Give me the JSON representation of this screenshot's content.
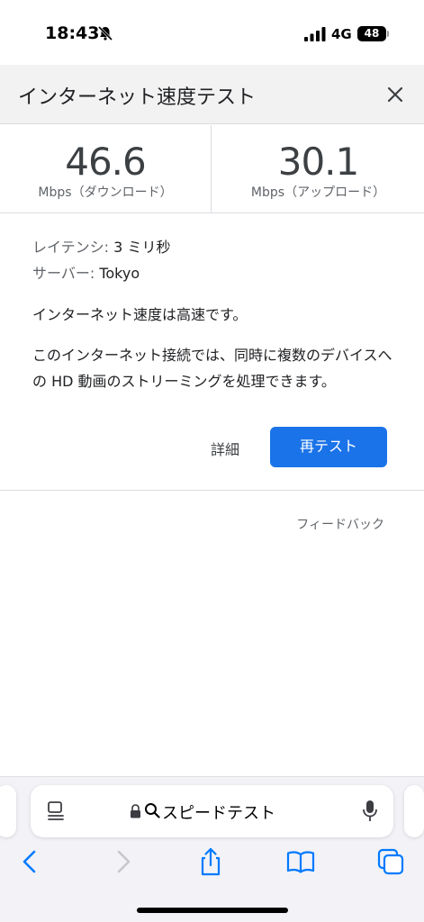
{
  "status_bar": {
    "time": "18:43",
    "network": "4G",
    "battery": "48"
  },
  "card": {
    "title": "インターネット速度テスト",
    "download": {
      "value": "46.6",
      "unit": "Mbps（ダウンロード）"
    },
    "upload": {
      "value": "30.1",
      "unit": "Mbps（アップロード）"
    },
    "latency_label": "レイテンシ:",
    "latency_value": "3 ミリ秒",
    "server_label": "サーバー:",
    "server_value": "Tokyo",
    "summary": "インターネット速度は高速です。",
    "description": "このインターネット接続では、同時に複数のデバイスへの HD 動画のストリーミングを処理できます。",
    "details_label": "詳細",
    "retest_label": "再テスト",
    "feedback_label": "フィードバック"
  },
  "browser": {
    "address_text": "スピードテスト"
  },
  "colors": {
    "accent": "#1a73e8",
    "ios_blue": "#007aff",
    "header_bg": "#f2f2f2"
  },
  "icons": [
    "bell-slash-icon",
    "signal-icon",
    "close-icon",
    "reader-icon",
    "lock-icon",
    "search-icon",
    "mic-icon",
    "back-icon",
    "forward-icon",
    "share-icon",
    "bookmarks-icon",
    "tabs-icon"
  ]
}
